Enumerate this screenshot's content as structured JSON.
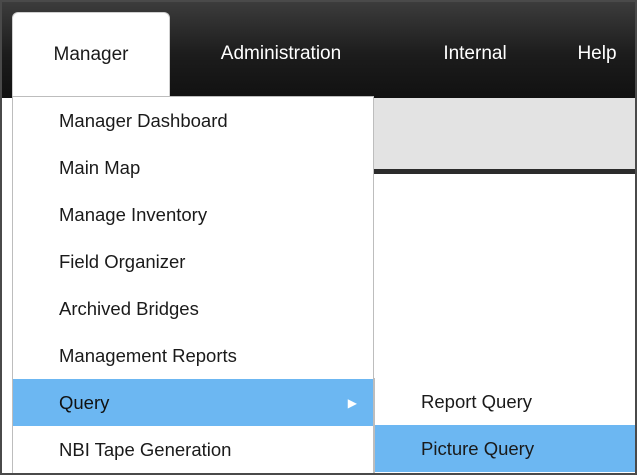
{
  "menubar": {
    "tabs": [
      {
        "label": "Manager",
        "active": true
      },
      {
        "label": "Administration"
      },
      {
        "label": "Internal"
      },
      {
        "label": "Help"
      }
    ]
  },
  "dropdown": {
    "items": [
      {
        "label": "Manager Dashboard"
      },
      {
        "label": "Main Map"
      },
      {
        "label": "Manage Inventory"
      },
      {
        "label": "Field Organizer"
      },
      {
        "label": "Archived Bridges"
      },
      {
        "label": "Management Reports"
      },
      {
        "label": "Query",
        "highlighted": true,
        "has_submenu": true
      },
      {
        "label": "NBI Tape Generation"
      }
    ]
  },
  "submenu": {
    "items": [
      {
        "label": "Report Query"
      },
      {
        "label": "Picture Query",
        "highlighted": true
      }
    ]
  },
  "colors": {
    "menubar_bg": "#1c1c1c",
    "highlight": "#6cb7f2",
    "active_tab_bg": "#ffffff"
  },
  "icons": {
    "submenu_indicator": "chevron-right-icon"
  }
}
